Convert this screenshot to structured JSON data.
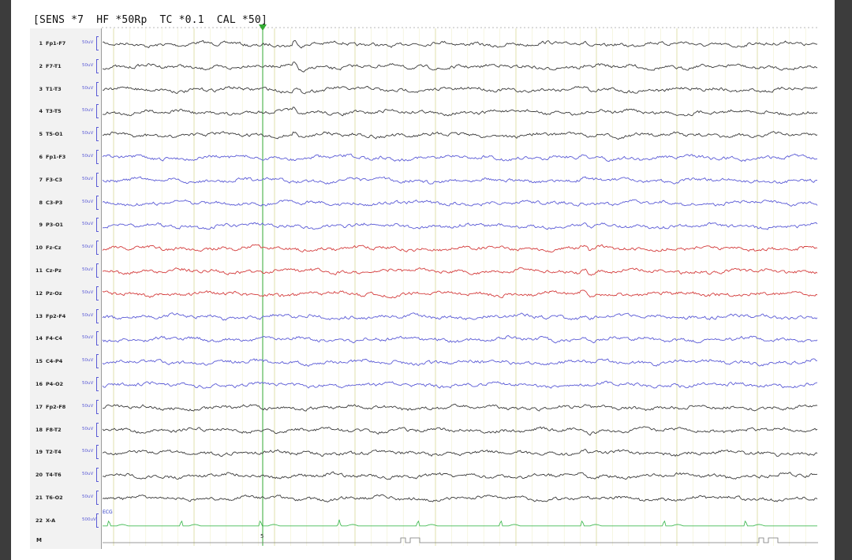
{
  "header": {
    "text": "[SENS *7  HF *50Rp  TC *0.1  CAL *50]"
  },
  "channels": [
    {
      "num": "1",
      "name": "Fp1-F7",
      "cal": "50uV",
      "color": "#3a3a3a"
    },
    {
      "num": "2",
      "name": "F7-T1",
      "cal": "50uV",
      "color": "#3a3a3a"
    },
    {
      "num": "3",
      "name": "T1-T3",
      "cal": "50uV",
      "color": "#3a3a3a"
    },
    {
      "num": "4",
      "name": "T3-T5",
      "cal": "50uV",
      "color": "#3a3a3a"
    },
    {
      "num": "5",
      "name": "T5-O1",
      "cal": "50uV",
      "color": "#3a3a3a"
    },
    {
      "num": "6",
      "name": "Fp1-F3",
      "cal": "50uV",
      "color": "#5b5bd6"
    },
    {
      "num": "7",
      "name": "F3-C3",
      "cal": "50uV",
      "color": "#5b5bd6"
    },
    {
      "num": "8",
      "name": "C3-P3",
      "cal": "50uV",
      "color": "#5b5bd6"
    },
    {
      "num": "9",
      "name": "P3-O1",
      "cal": "50uV",
      "color": "#5b5bd6"
    },
    {
      "num": "10",
      "name": "Fz-Cz",
      "cal": "50uV",
      "color": "#d43c3c"
    },
    {
      "num": "11",
      "name": "Cz-Pz",
      "cal": "50uV",
      "color": "#d43c3c"
    },
    {
      "num": "12",
      "name": "Pz-Oz",
      "cal": "50uV",
      "color": "#d43c3c"
    },
    {
      "num": "13",
      "name": "Fp2-F4",
      "cal": "50uV",
      "color": "#5b5bd6"
    },
    {
      "num": "14",
      "name": "F4-C4",
      "cal": "50uV",
      "color": "#5b5bd6"
    },
    {
      "num": "15",
      "name": "C4-P4",
      "cal": "50uV",
      "color": "#5b5bd6"
    },
    {
      "num": "16",
      "name": "P4-O2",
      "cal": "50uV",
      "color": "#5b5bd6"
    },
    {
      "num": "17",
      "name": "Fp2-F8",
      "cal": "50uV",
      "color": "#3a3a3a"
    },
    {
      "num": "18",
      "name": "F8-T2",
      "cal": "50uV",
      "color": "#3a3a3a"
    },
    {
      "num": "19",
      "name": "T2-T4",
      "cal": "50uV",
      "color": "#3a3a3a"
    },
    {
      "num": "20",
      "name": "T4-T6",
      "cal": "50uV",
      "color": "#3a3a3a"
    },
    {
      "num": "21",
      "name": "T6-O2",
      "cal": "50uV",
      "color": "#3a3a3a"
    },
    {
      "num": "22",
      "name": "X-A",
      "cal": "500uV",
      "color": "#44bb55"
    }
  ],
  "marker_row": {
    "label": "M"
  },
  "ecg_tag": "ECG",
  "second_mark": "5",
  "colors": {
    "grid_major": "#d8d89a",
    "grid_minor": "#efefcf",
    "cursor": "#33aa33"
  }
}
